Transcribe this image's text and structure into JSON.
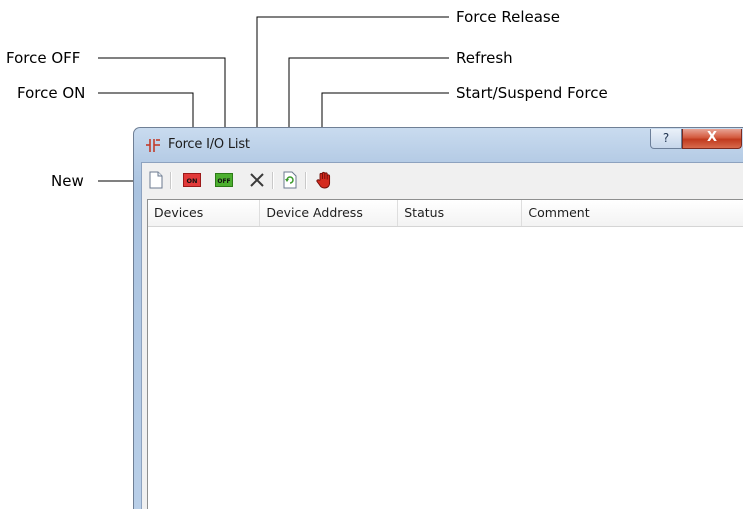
{
  "callouts": {
    "force_release": "Force Release",
    "force_off": "Force OFF",
    "refresh": "Refresh",
    "force_on": "Force ON",
    "start_suspend": "Start/Suspend Force",
    "new": "New"
  },
  "window": {
    "title": "Force I/O List",
    "help_label": "?",
    "close_label": "X"
  },
  "toolbar": {
    "on_label": "ON",
    "off_label": "OFF"
  },
  "list": {
    "columns": [
      "Devices",
      "Device Address",
      "Status",
      "Comment"
    ],
    "rows": []
  },
  "colors": {
    "on_button": "#e23a3a",
    "off_button": "#4caf2f",
    "title_bar": "#b9cfe8",
    "close_button": "#c13a1e"
  }
}
